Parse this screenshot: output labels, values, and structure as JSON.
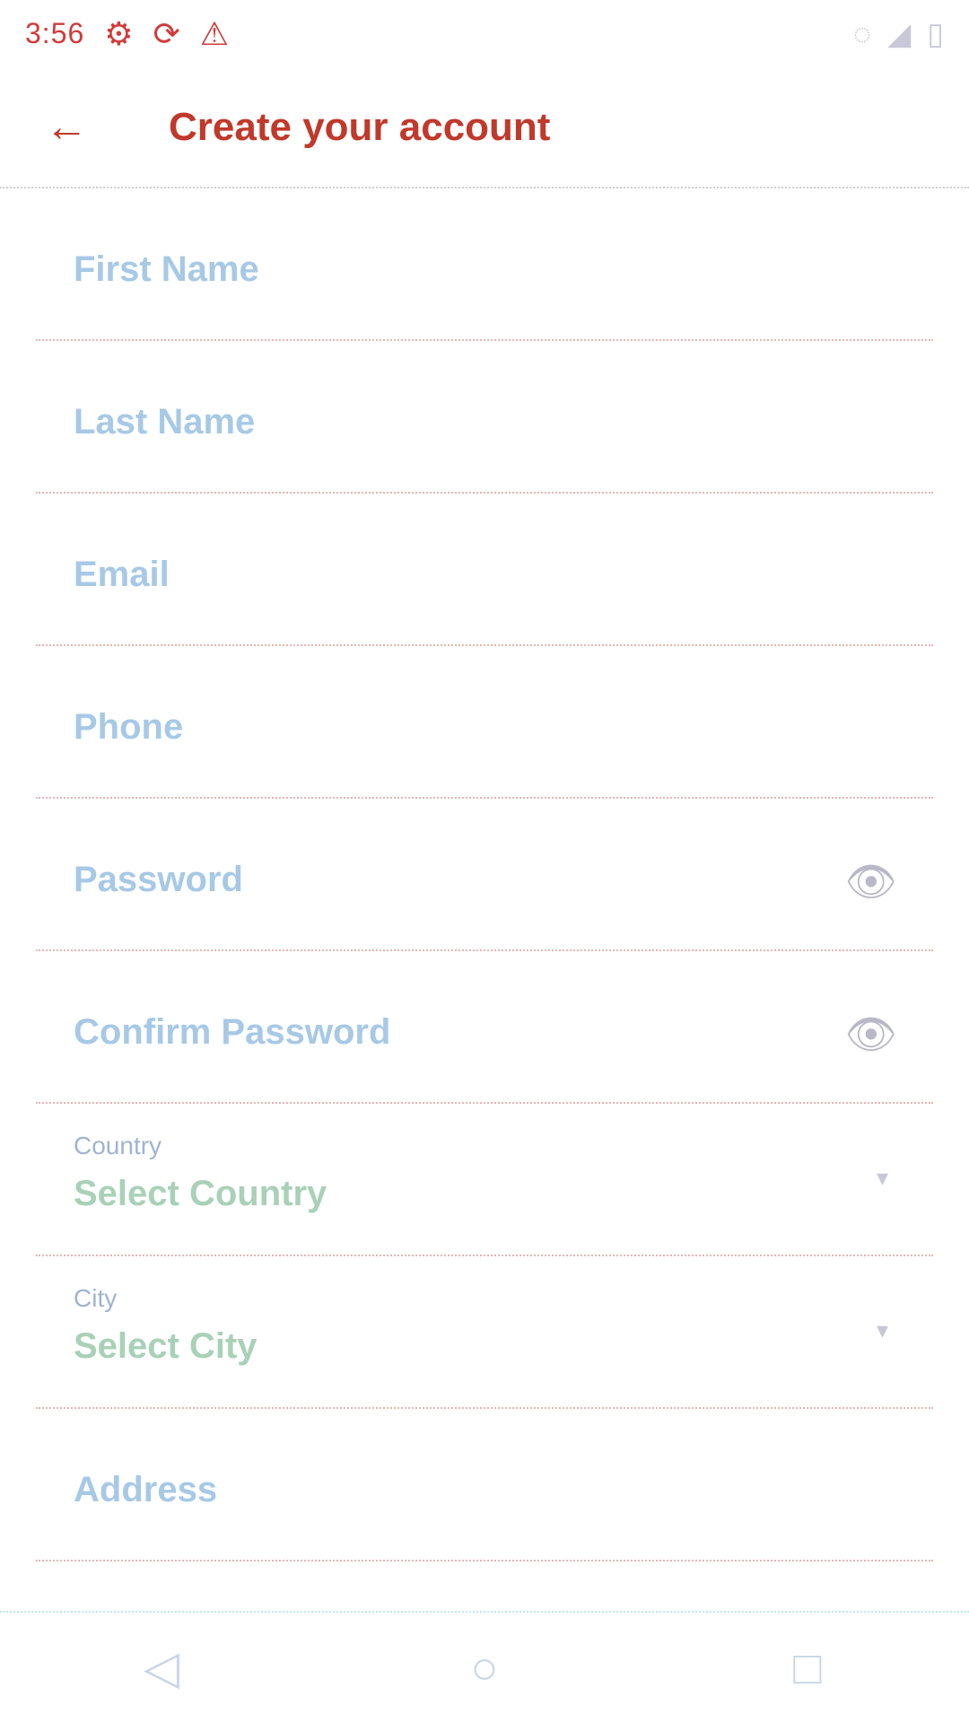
{
  "status_bar": {
    "time": "3:56",
    "left_icons": [
      "gear-icon",
      "sync-icon",
      "warning-icon"
    ],
    "right_icons": [
      "wifi-icon",
      "signal-icon",
      "battery-icon"
    ]
  },
  "app_bar": {
    "title": "Create your account",
    "back_icon": "arrow-left-icon"
  },
  "fields": [
    {
      "label": "First Name"
    },
    {
      "label": "Last Name"
    },
    {
      "label": "Email"
    },
    {
      "label": "Phone"
    },
    {
      "label": "Password",
      "icon": "eye-icon"
    },
    {
      "label": "Confirm Password",
      "icon": "eye-icon"
    },
    {
      "caption": "Country",
      "value": "Select Country"
    },
    {
      "caption": "City",
      "value": "Select City"
    },
    {
      "label": "Address"
    }
  ],
  "nav_bar": {
    "back": "back-icon",
    "home": "home-icon",
    "recents": "recents-icon"
  },
  "colors": {
    "accent": "#c0392b",
    "label": "#a7c9e6",
    "divider": "#e6b4b4"
  }
}
